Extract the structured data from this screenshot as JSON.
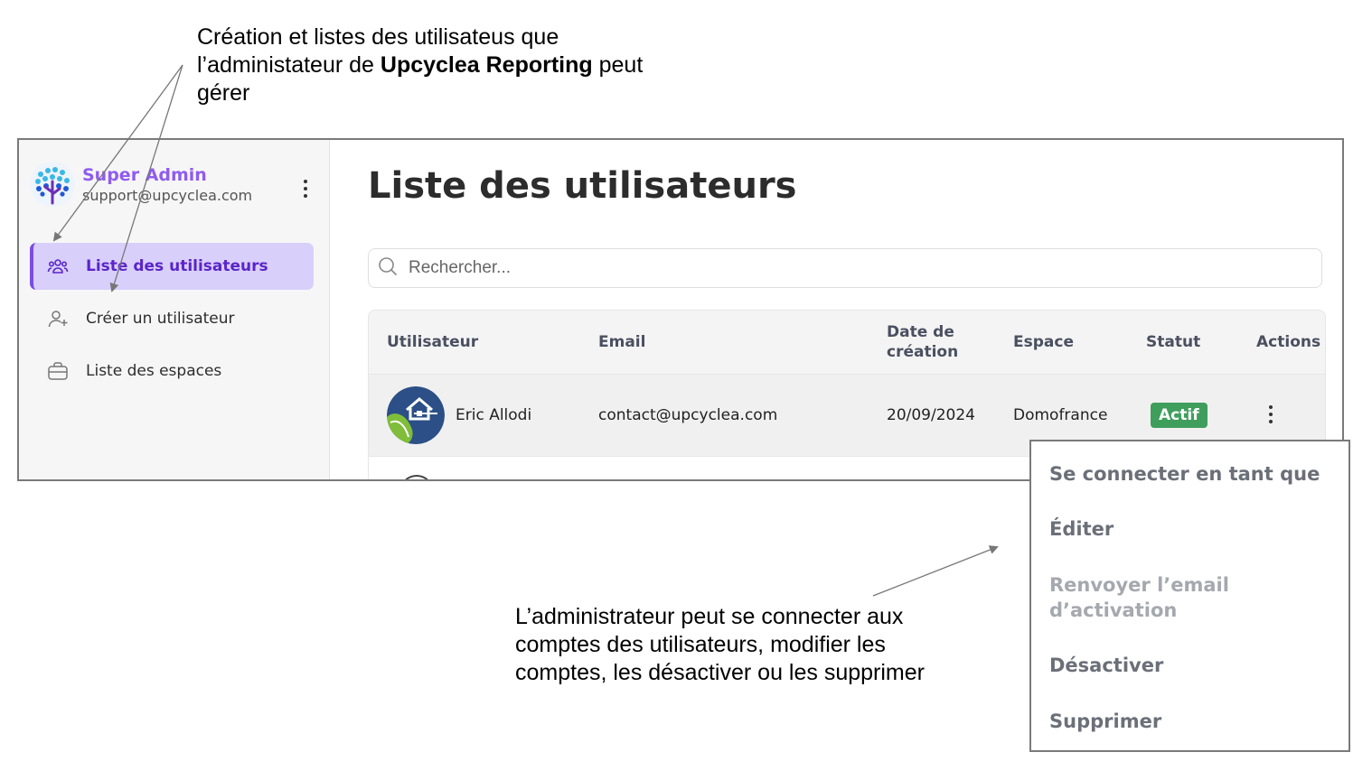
{
  "annotations": {
    "top_line1": "Création et listes des utilisateus que",
    "top_line2_pre": "l’administateur de ",
    "top_line2_bold": "Upcyclea Reporting",
    "top_line2_post": " peut",
    "top_line3": "gérer",
    "bottom_line1": "L’administrateur peut se connecter aux",
    "bottom_line2": "comptes des utilisateurs, modifier les",
    "bottom_line3": "comptes, les désactiver ou les supprimer"
  },
  "profile": {
    "name": "Super Admin",
    "email": "support@upcyclea.com"
  },
  "sidebar": {
    "items": [
      {
        "label": "Liste des utilisateurs",
        "icon": "users-icon",
        "active": true
      },
      {
        "label": "Créer un utilisateur",
        "icon": "user-plus-icon",
        "active": false
      },
      {
        "label": "Liste des espaces",
        "icon": "briefcase-icon",
        "active": false
      }
    ]
  },
  "main": {
    "title": "Liste des utilisateurs",
    "search_placeholder": "Rechercher..."
  },
  "table": {
    "headers": {
      "user": "Utilisateur",
      "email": "Email",
      "date_line1": "Date de",
      "date_line2": "création",
      "space": "Espace",
      "status": "Statut",
      "actions": "Actions"
    },
    "rows": [
      {
        "name": "Eric Allodi",
        "email": "contact@upcyclea.com",
        "date": "20/09/2024",
        "space": "Domofrance",
        "status": "Actif"
      }
    ]
  },
  "dropdown": {
    "items": [
      {
        "label": "Se connecter en tant que",
        "disabled": false
      },
      {
        "label": "Éditer",
        "disabled": false
      },
      {
        "label_line1": "Renvoyer l’email",
        "label_line2": "d’activation",
        "disabled": true
      },
      {
        "label": "Désactiver",
        "disabled": false
      },
      {
        "label": "Supprimer",
        "disabled": false
      }
    ]
  },
  "colors": {
    "accent": "#8f5cf0",
    "active_bg": "#d9cffb",
    "status_green": "#3f9e5c"
  }
}
